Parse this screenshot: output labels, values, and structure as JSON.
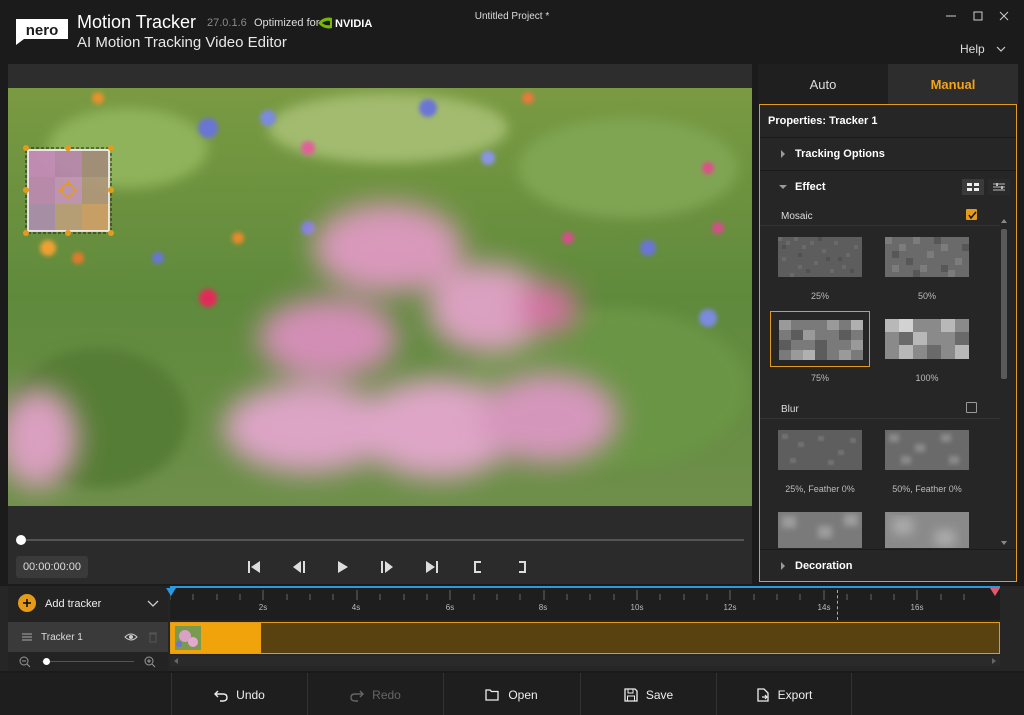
{
  "window": {
    "app_name": "Motion Tracker",
    "version": "27.0.1.6",
    "optimized_for": "Optimized for",
    "nvidia": "NVIDIA",
    "subtitle": "AI Motion Tracking Video Editor",
    "project_title": "Untitled Project *",
    "help": "Help",
    "logo_text": "nero"
  },
  "player": {
    "timecode": "00:00:00:00",
    "progress": 0
  },
  "tabs": [
    {
      "label": "Auto",
      "active": false
    },
    {
      "label": "Manual",
      "active": true
    }
  ],
  "properties": {
    "title": "Properties: Tracker 1",
    "tracking_options": "Tracking Options",
    "effect": "Effect",
    "decoration": "Decoration",
    "mosaic": {
      "label": "Mosaic",
      "checked": true,
      "options": [
        "25%",
        "50%",
        "75%",
        "100%"
      ],
      "selected": "75%"
    },
    "blur": {
      "label": "Blur",
      "checked": false,
      "options": [
        "25%, Feather 0%",
        "50%, Feather 0%"
      ]
    }
  },
  "timeline": {
    "add_tracker": "Add tracker",
    "tracker_name": "Tracker 1",
    "ticks": [
      "2s",
      "4s",
      "6s",
      "8s",
      "10s",
      "12s",
      "14s",
      "16s"
    ]
  },
  "toolbar": {
    "undo": "Undo",
    "redo": "Redo",
    "open": "Open",
    "save": "Save",
    "export": "Export"
  },
  "colors": {
    "accent": "#e59b1a",
    "accent_bright": "#f3a41b",
    "background": "#1b1b1b"
  }
}
